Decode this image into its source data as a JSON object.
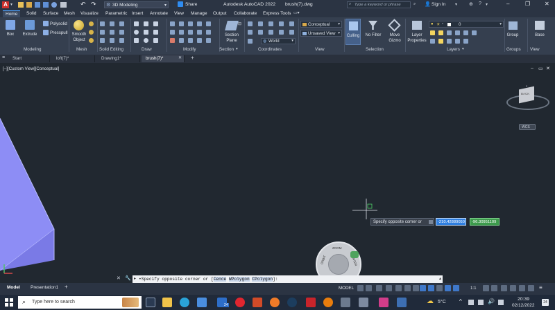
{
  "title_bar": {
    "app_title": "Autodesk AutoCAD 2022",
    "file_name": "brush(7).dwg",
    "workspace": "3D Modeling",
    "share_label": "Share",
    "search_placeholder": "Type a keyword or phrase",
    "sign_in": "Sign In"
  },
  "ribbon_tabs": [
    "Home",
    "Solid",
    "Surface",
    "Mesh",
    "Visualize",
    "Parametric",
    "Insert",
    "Annotate",
    "View",
    "Manage",
    "Output",
    "Collaborate",
    "Express Tools"
  ],
  "ribbon": {
    "box": "Box",
    "extrude": "Extrude",
    "polysolid": "Polysolid",
    "presspull": "Presspull",
    "smooth_object_1": "Smooth",
    "smooth_object_2": "Object",
    "section_plane_1": "Section",
    "section_plane_2": "Plane",
    "visual_style": "Conceptual",
    "view_state": "Unsaved View",
    "ucs": "World",
    "culling": "Culling",
    "no_filter": "No Filter",
    "move_gizmo_1": "Move",
    "move_gizmo_2": "Gizmo",
    "layer_properties_1": "Layer",
    "layer_properties_2": "Properties",
    "layer_value": "0",
    "group": "Group",
    "base": "Base",
    "panels": [
      "Modeling",
      "Mesh",
      "Solid Editing",
      "Draw",
      "Modify",
      "Section",
      "Coordinates",
      "View",
      "Selection",
      "Layers",
      "Groups",
      "View"
    ]
  },
  "doc_tabs": [
    "Start",
    "loft(7)*",
    "Drawing1*",
    "brush(7)*"
  ],
  "viewport": {
    "label": "[–][Custom View][Conceptual]",
    "prompt": "Specify opposite corner or",
    "coord_x": "-210.42889050",
    "coord_y": "-96.30951109",
    "wheel_top": "ZOOM",
    "wheel_left": "ORBIT",
    "wheel_right": "CENTER",
    "viewcube_back": "BACK",
    "viewcube_wcs": "WCS"
  },
  "command": {
    "prefix": "•Specify opposite corner or [",
    "opt1": "Fence",
    "opt2": "WPolygon",
    "opt3": "CPolygon",
    "suffix": "]:"
  },
  "layouts": [
    "Model",
    "Presentation1"
  ],
  "status": {
    "model": "MODEL",
    "scale": "1:1"
  },
  "taskbar": {
    "search_placeholder": "Type here to search",
    "weather": "5°C",
    "time": "20:39",
    "date": "02/12/2022",
    "badge_count": "24"
  }
}
